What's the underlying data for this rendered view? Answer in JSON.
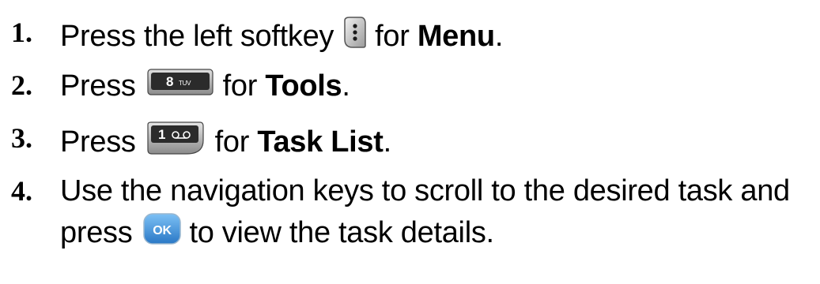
{
  "steps": [
    {
      "number": "1.",
      "before": "Press the left softkey",
      "key_icon": "left-softkey-icon",
      "mid": "for",
      "bold": "Menu",
      "after": "."
    },
    {
      "number": "2.",
      "before": "Press",
      "key_icon": "key-8-tuv-icon",
      "key_digit": "8",
      "key_letters": "TUV",
      "mid": "for",
      "bold": "Tools",
      "after": "."
    },
    {
      "number": "3.",
      "before": "Press",
      "key_icon": "key-1-voicemail-icon",
      "key_digit": "1",
      "mid": "for",
      "bold": "Task List",
      "after": "."
    },
    {
      "number": "4.",
      "line1": "Use the navigation keys to scroll to the desired task and",
      "line2_before": "press",
      "key_icon": "ok-key-icon",
      "key_label": "OK",
      "line2_after": "to view the task details."
    }
  ],
  "colors": {
    "text": "#000000",
    "ok_key_blue": "#3a8fd9",
    "key_dark": "#2a2a2a",
    "key_light": "#d9d9d9"
  }
}
